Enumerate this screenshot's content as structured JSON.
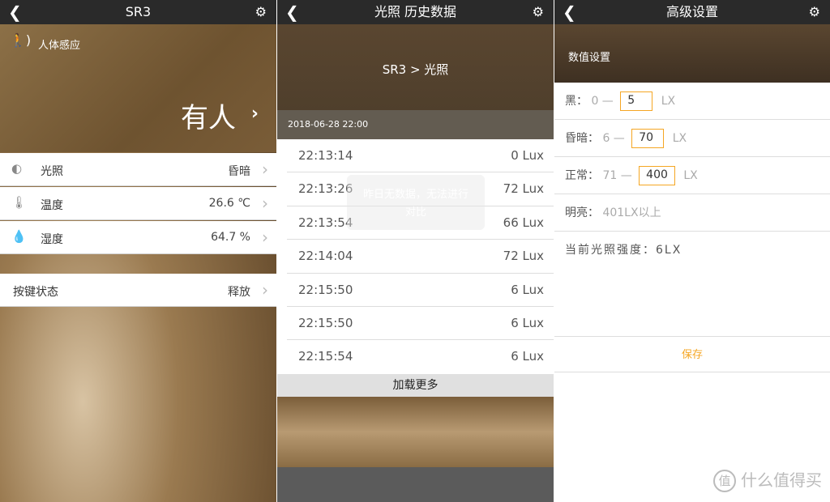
{
  "screen1": {
    "title": "SR3",
    "sensor_label": "人体感应",
    "sensor_state": "有人",
    "rows": [
      {
        "icon": "light-icon",
        "label": "光照",
        "value": "昏暗"
      },
      {
        "icon": "thermometer-icon",
        "label": "温度",
        "value": "26.6 ℃"
      },
      {
        "icon": "humidity-drop-icon",
        "label": "湿度",
        "value": "64.7 %"
      }
    ],
    "button_row": {
      "label": "按键状态",
      "value": "释放"
    }
  },
  "screen2": {
    "title": "光照 历史数据",
    "breadcrumb": "SR3 > 光照",
    "date": "2018-06-28 22:00",
    "records": [
      {
        "time": "22:13:14",
        "value": "0 Lux"
      },
      {
        "time": "22:13:26",
        "value": "72 Lux"
      },
      {
        "time": "22:13:54",
        "value": "66 Lux"
      },
      {
        "time": "22:14:04",
        "value": "72 Lux"
      },
      {
        "time": "22:15:50",
        "value": "6 Lux"
      },
      {
        "time": "22:15:50",
        "value": "6 Lux"
      },
      {
        "time": "22:15:54",
        "value": "6 Lux"
      }
    ],
    "toast": "昨日无数据，无法进行对比",
    "load_more": "加载更多"
  },
  "screen3": {
    "title": "高级设置",
    "section": "数值设置",
    "dark": {
      "label": "黑：",
      "min": "0 —",
      "max": "5",
      "unit": "LX"
    },
    "dim": {
      "label": "昏暗：",
      "min": "6 —",
      "max": "70",
      "unit": "LX"
    },
    "normal": {
      "label": "正常：",
      "min": "71 —",
      "max": "400",
      "unit": "LX"
    },
    "bright": {
      "label": "明亮：",
      "value": "401LX以上"
    },
    "current": "当前光照强度：6LX",
    "save": "保存"
  },
  "watermark": {
    "logo": "值",
    "text": "什么值得买"
  },
  "colors": {
    "accent": "#f5a623",
    "header": "#2a2a2a"
  }
}
